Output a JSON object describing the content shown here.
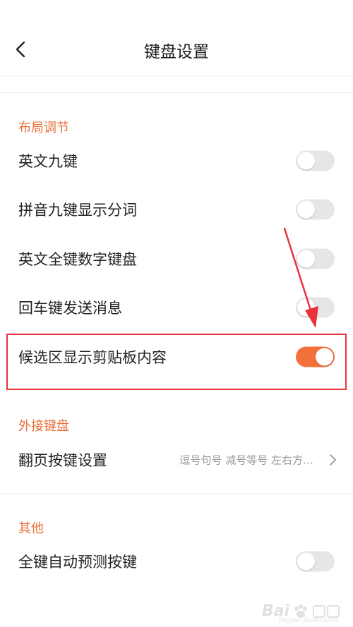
{
  "header": {
    "title": "键盘设置"
  },
  "sections": [
    {
      "title": "布局调节",
      "items": [
        {
          "label": "英文九键",
          "on": false
        },
        {
          "label": "拼音九键显示分词",
          "on": false
        },
        {
          "label": "英文全键数字键盘",
          "on": false
        },
        {
          "label": "回车键发送消息",
          "on": false
        },
        {
          "label": "候选区显示剪贴板内容",
          "on": true
        }
      ]
    },
    {
      "title": "外接键盘",
      "items": [
        {
          "label": "翻页按键设置",
          "value": "逗号句号 减号等号 左右方…"
        }
      ]
    },
    {
      "title": "其他",
      "items": [
        {
          "label": "全键自动预测按键",
          "on": false
        }
      ]
    }
  ],
  "colors": {
    "accent": "#f2703a",
    "highlight": "#e8333a",
    "section_title": "#e8713a"
  },
  "watermark": {
    "text": "Bai",
    "sub": "jingyan.baidu.com"
  }
}
